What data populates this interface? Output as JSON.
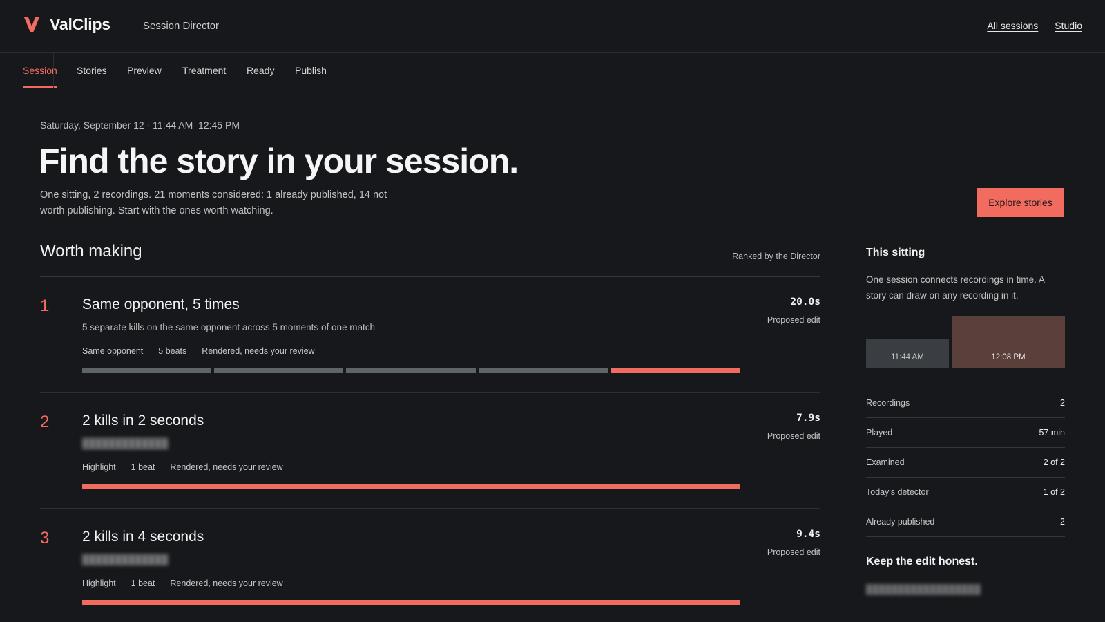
{
  "header": {
    "brand_name": "ValClips",
    "app_title": "Session Director",
    "links": [
      "All sessions",
      "Studio"
    ],
    "accent_color": "#f26b5f"
  },
  "tabs": [
    {
      "label": "Session",
      "active": true
    },
    {
      "label": "Stories",
      "active": false
    },
    {
      "label": "Preview",
      "active": false
    },
    {
      "label": "Treatment",
      "active": false
    },
    {
      "label": "Ready",
      "active": false
    },
    {
      "label": "Publish",
      "active": false
    }
  ],
  "hero": {
    "date": "Saturday, September 12 · 11:44 AM–12:45 PM",
    "headline": "Find the story in your session.",
    "intro": "One sitting, 2 recordings. 21 moments considered: 1 already published, 14 not worth publishing. Start with the ones worth watching.",
    "cta_label": "Explore stories"
  },
  "worth_making": {
    "title": "Worth making",
    "ranked_note": "Ranked by the Director",
    "stories": [
      {
        "rank": "1",
        "title": "Same opponent, 5 times",
        "description": "5 separate kills on the same opponent across 5 moments of one match",
        "tags": [
          "Same opponent",
          "5 beats",
          "Rendered, needs your review"
        ],
        "duration": "20.0s",
        "status": "Proposed edit",
        "beats": [
          false,
          false,
          false,
          false,
          true
        ]
      },
      {
        "rank": "2",
        "title": "2 kills in 2 seconds",
        "description": "",
        "tags": [
          "Highlight",
          "1 beat",
          "Rendered, needs your review"
        ],
        "duration": "7.9s",
        "status": "Proposed edit",
        "beats": [
          true
        ]
      },
      {
        "rank": "3",
        "title": "2 kills in 4 seconds",
        "description": "",
        "tags": [
          "Highlight",
          "1 beat",
          "Rendered, needs your review"
        ],
        "duration": "9.4s",
        "status": "Proposed edit",
        "beats": [
          true
        ]
      }
    ]
  },
  "sidebar": {
    "title": "This sitting",
    "description": "One session connects recordings in time. A story can draw on any recording in it.",
    "recordings": [
      "11:44 AM",
      "12:08 PM"
    ],
    "stats": [
      {
        "label": "Recordings",
        "value": "2"
      },
      {
        "label": "Played",
        "value": "57 min"
      },
      {
        "label": "Examined",
        "value": "2 of 2"
      },
      {
        "label": "Today's detector",
        "value": "1 of 2"
      },
      {
        "label": "Already published",
        "value": "2"
      }
    ],
    "honest_title": "Keep the edit honest.",
    "honest_body": ""
  }
}
